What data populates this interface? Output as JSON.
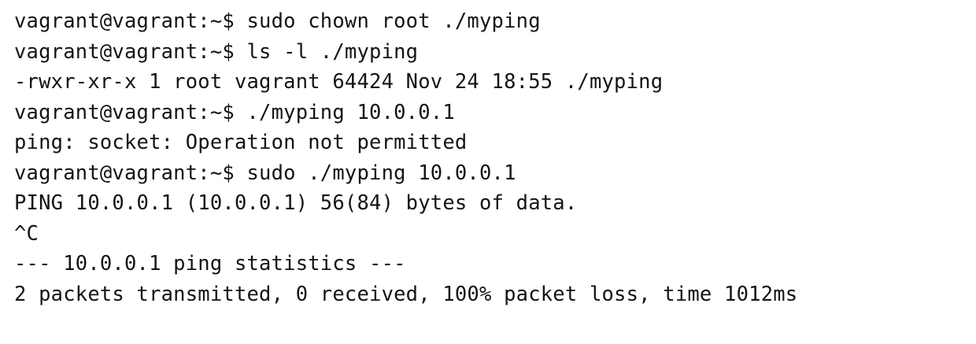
{
  "terminal": {
    "lines": [
      "vagrant@vagrant:~$ sudo chown root ./myping",
      "vagrant@vagrant:~$ ls -l ./myping",
      "-rwxr-xr-x 1 root vagrant 64424 Nov 24 18:55 ./myping",
      "vagrant@vagrant:~$ ./myping 10.0.0.1",
      "ping: socket: Operation not permitted",
      "vagrant@vagrant:~$ sudo ./myping 10.0.0.1",
      "PING 10.0.0.1 (10.0.0.1) 56(84) bytes of data.",
      "^C",
      "--- 10.0.0.1 ping statistics ---",
      "2 packets transmitted, 0 received, 100% packet loss, time 1012ms"
    ]
  }
}
